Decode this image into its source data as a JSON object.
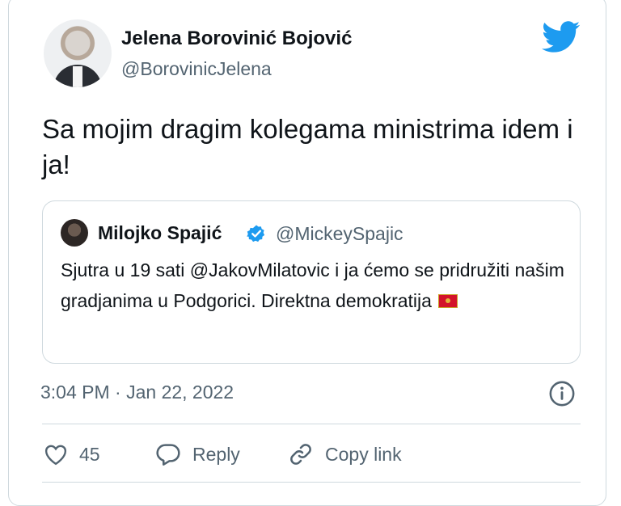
{
  "author": {
    "name": "Jelena Borovinić Bojović",
    "handle": "@BorovinicJelena"
  },
  "tweet": {
    "text": "Sa mojim dragim kolegama ministrima idem i ja!"
  },
  "quoted": {
    "name": "Milojko Spajić",
    "handle": "@MickeySpajic",
    "text": "Sjutra u 19 sati @JakovMilatovic i ja ćemo se pridružiti našim gradjanima u Podgorici. Direktna demokratija"
  },
  "meta": {
    "timestamp": "3:04 PM · Jan 22, 2022"
  },
  "actions": {
    "like_count": "45",
    "reply_label": "Reply",
    "copy_label": "Copy link"
  },
  "icons": {
    "brand": "twitter-bird-icon",
    "verified": "verified-badge-icon",
    "info": "info-icon",
    "like": "heart-icon",
    "reply": "reply-bubble-icon",
    "copy": "link-icon",
    "flag": "montenegro-flag-icon"
  },
  "colors": {
    "twitter_blue": "#1d9bf0",
    "secondary_text": "#536471",
    "border": "#cfd9de"
  }
}
